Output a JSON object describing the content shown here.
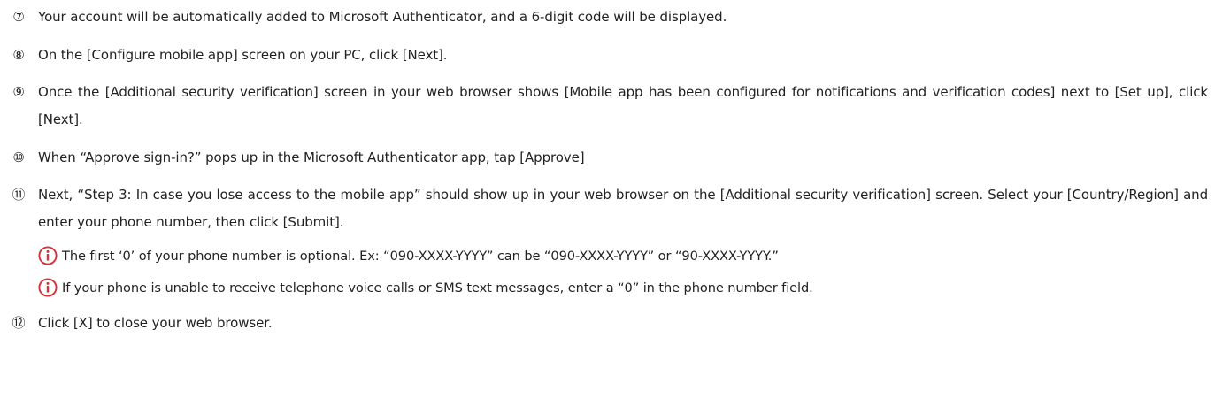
{
  "steps": [
    {
      "number": "⑦",
      "text": "Your account will be automatically added to Microsoft Authenticator, and a 6-digit code will be displayed."
    },
    {
      "number": "⑧",
      "text": "On the [Configure mobile app] screen on your PC, click [Next]."
    },
    {
      "number": "⑨",
      "text": "Once the [Additional security verification] screen in your web browser shows [Mobile app has been configured for notifications and verification codes] next to [Set up], click [Next]."
    },
    {
      "number": "⑩",
      "text": "When “Approve sign-in?” pops up in the Microsoft Authenticator app, tap [Approve]"
    },
    {
      "number": "⑪",
      "text": "Next, “Step 3: In case you lose access to the mobile app” should show up in your web browser on the [Additional security verification] screen. Select your [Country/Region] and enter your phone number, then click [Submit]."
    },
    {
      "number": "⑫",
      "text": "Click [X] to close your web browser."
    }
  ],
  "notes": [
    {
      "icon": "info-icon",
      "text": "The first ‘0’ of your phone number is optional. Ex: “090-XXXX-YYYY” can be “090-XXXX-YYYY” or “90-XXXX-YYYY.”"
    },
    {
      "icon": "info-icon",
      "text": "If your phone is unable to receive telephone voice calls or SMS text messages, enter a “0” in the phone number field."
    }
  ],
  "colors": {
    "text": "#222222",
    "info_icon": "#d9303a"
  }
}
